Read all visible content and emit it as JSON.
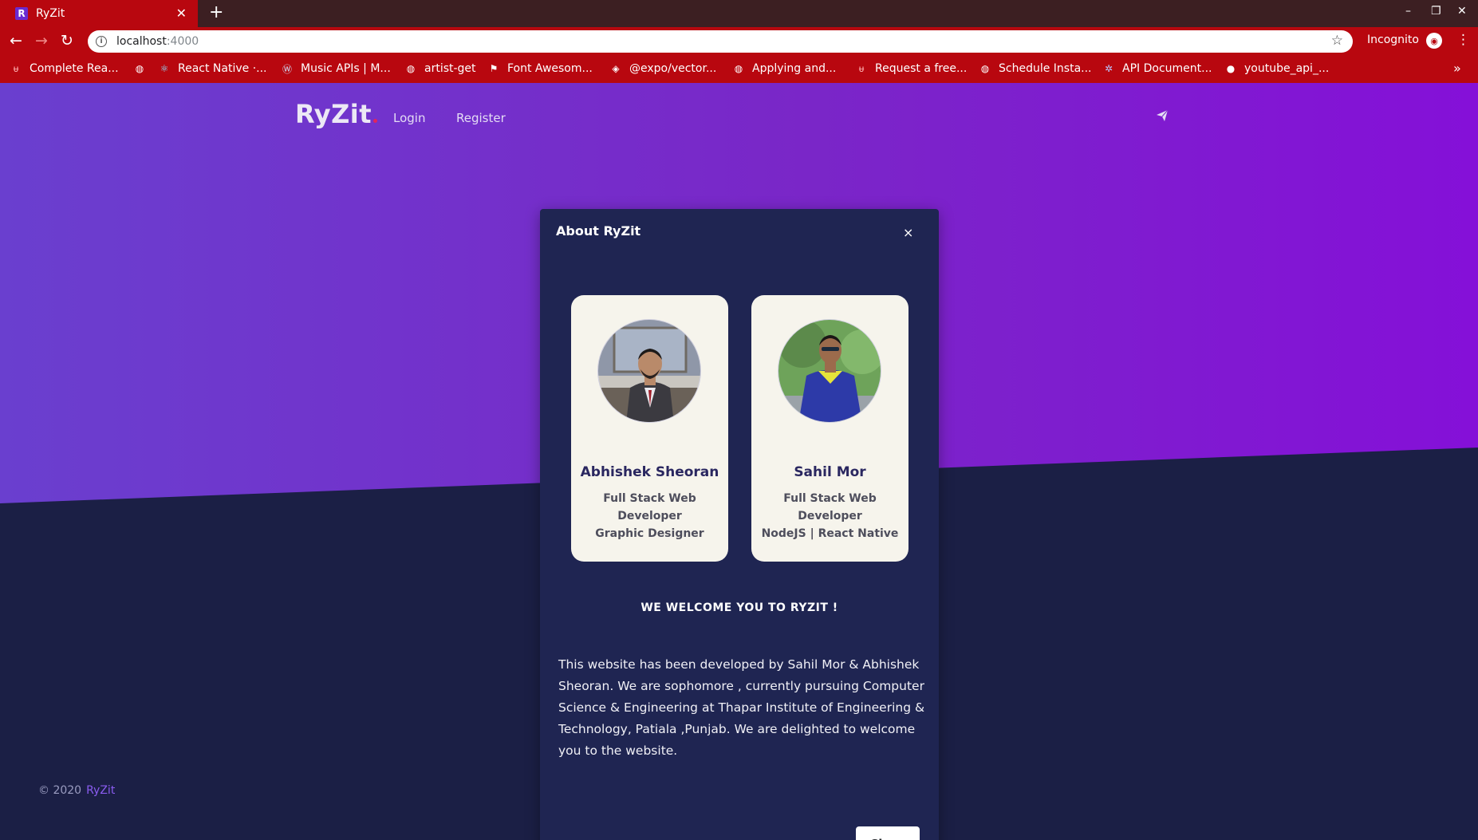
{
  "browser": {
    "tab_title": "RyZit",
    "tab_favicon": "R",
    "url_host": "localhost",
    "url_port": ":4000",
    "incognito_label": "Incognito",
    "bookmarks": [
      {
        "label": "Complete Rea...",
        "icon": "react-icon"
      },
      {
        "label": "",
        "icon": "globe-icon"
      },
      {
        "label": "React Native ·...",
        "icon": "react-atom-icon"
      },
      {
        "label": "Music APIs | M...",
        "icon": "wordpress-icon"
      },
      {
        "label": "artist-get",
        "icon": "globe-icon"
      },
      {
        "label": "Font Awesom...",
        "icon": "flag-icon"
      },
      {
        "label": "@expo/vector...",
        "icon": "expo-icon"
      },
      {
        "label": "Applying and...",
        "icon": "globe-icon"
      },
      {
        "label": "Request a free...",
        "icon": "react-icon"
      },
      {
        "label": "Schedule Insta...",
        "icon": "globe-icon"
      },
      {
        "label": "API Document...",
        "icon": "asterisk-icon"
      },
      {
        "label": "youtube_api_...",
        "icon": "github-icon"
      }
    ]
  },
  "site": {
    "brand": "RyZit",
    "nav": {
      "login": "Login",
      "register": "Register"
    },
    "footer": {
      "copyright": "© 2020",
      "brand": "RyZit"
    }
  },
  "modal": {
    "title": "About RyZit",
    "close_x": "×",
    "cards": [
      {
        "name": "Abhishek Sheoran",
        "role_line1": "Full Stack Web Developer",
        "role_line2": "Graphic Designer"
      },
      {
        "name": "Sahil Mor",
        "role_line1": "Full Stack Web Developer",
        "role_line2": "NodeJS | React Native"
      }
    ],
    "welcome": "WE WELCOME YOU TO RYZIT !",
    "about_text": "This website has been developed by Sahil Mor & Abhishek Sheoran. We are sophomore , currently pursuing Computer Science & Engineering at Thapar Institute of Engineering & Technology, Patiala ,Punjab. We are delighted to welcome you to the website.",
    "close_button": "Close"
  },
  "colors": {
    "chrome_red": "#b8070f",
    "hero_purple": "#7a26c8",
    "page_navy": "#1b1f45",
    "modal_navy": "#1f2552",
    "card_cream": "#f6f4ec"
  }
}
